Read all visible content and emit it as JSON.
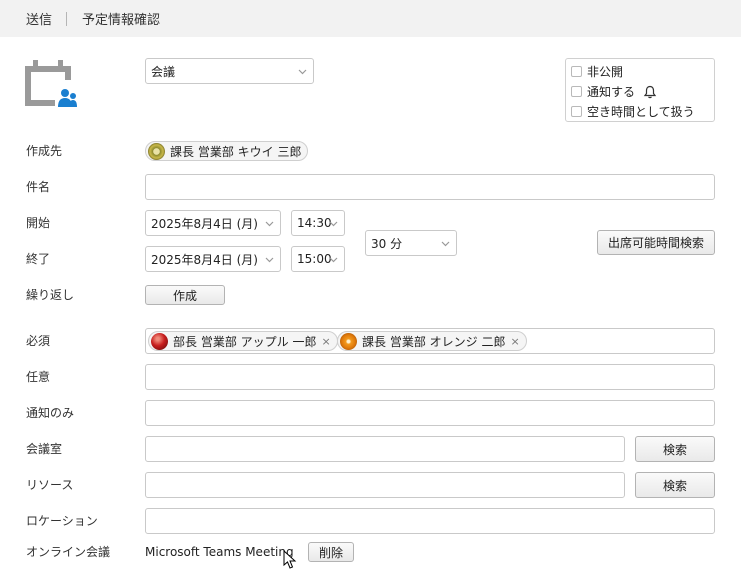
{
  "topbar": {
    "send": "送信",
    "confirm": "予定情報確認"
  },
  "meeting_type": {
    "value": "会議"
  },
  "options": {
    "private": "非公開",
    "notify": "通知する",
    "free_time": "空き時間として扱う"
  },
  "labels": {
    "creator": "作成先",
    "subject": "件名",
    "start": "開始",
    "end": "終了",
    "repeat": "繰り返し",
    "required": "必須",
    "optional": "任意",
    "notify_only": "通知のみ",
    "room": "会議室",
    "resource": "リソース",
    "location": "ロケーション",
    "online": "オンライン会議"
  },
  "creator": {
    "name": "課長 営業部 キウイ 三郎"
  },
  "start": {
    "date": "2025年8月4日 (月)",
    "time": "14:30"
  },
  "end": {
    "date": "2025年8月4日 (月)",
    "time": "15:00"
  },
  "duration": "30 分",
  "buttons": {
    "availability": "出席可能時間検索",
    "create": "作成",
    "search_room": "検索",
    "search_resource": "検索",
    "delete": "削除"
  },
  "required_attendees": [
    {
      "name": "部長 営業部 アップル 一郎",
      "remove": "×"
    },
    {
      "name": "課長 営業部 オレンジ 二郎",
      "remove": "×"
    }
  ],
  "online_meeting": {
    "value": "Microsoft Teams Meeting"
  },
  "colors": {
    "accent": "#1a7fd0",
    "topbar": "#f2f2f2",
    "calendar_icon": "#9a9a9a"
  }
}
